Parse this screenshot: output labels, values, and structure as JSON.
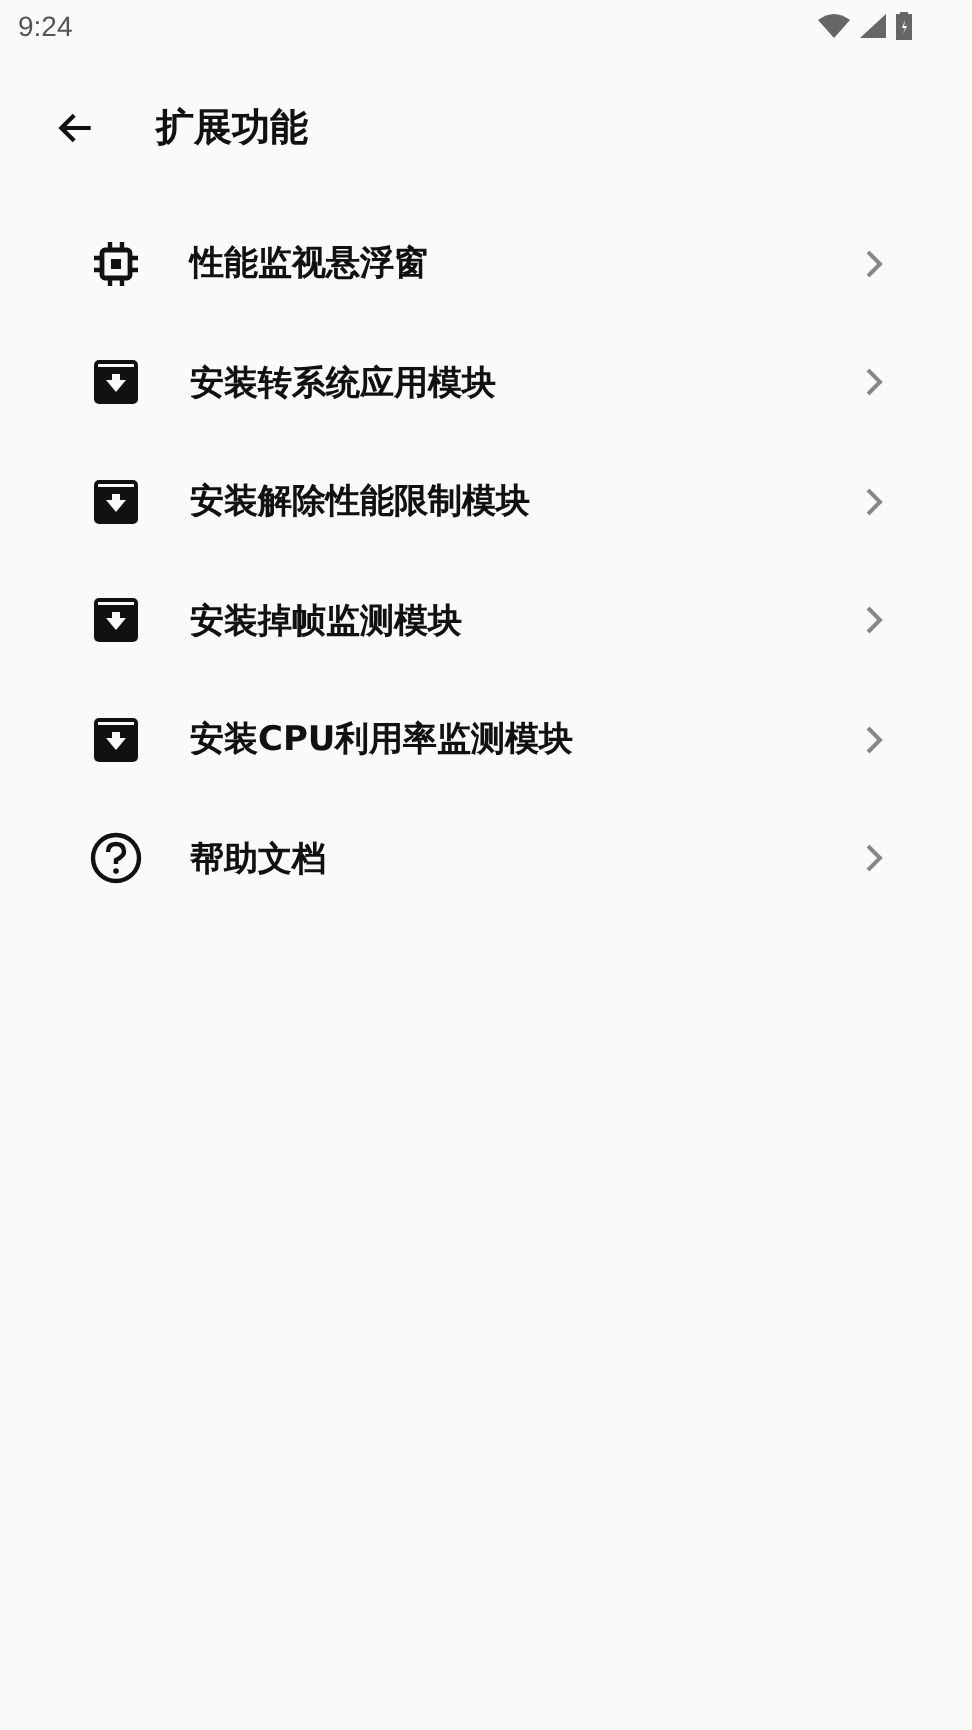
{
  "status_bar": {
    "time": "9:24"
  },
  "app_bar": {
    "title": "扩展功能"
  },
  "items": [
    {
      "kind": "chip",
      "label": "性能监视悬浮窗"
    },
    {
      "kind": "install",
      "label": "安装转系统应用模块"
    },
    {
      "kind": "install",
      "label": "安装解除性能限制模块"
    },
    {
      "kind": "install",
      "label": "安装掉帧监测模块"
    },
    {
      "kind": "install",
      "label": "安装CPU利用率监测模块"
    },
    {
      "kind": "help",
      "label": "帮助文档"
    }
  ]
}
